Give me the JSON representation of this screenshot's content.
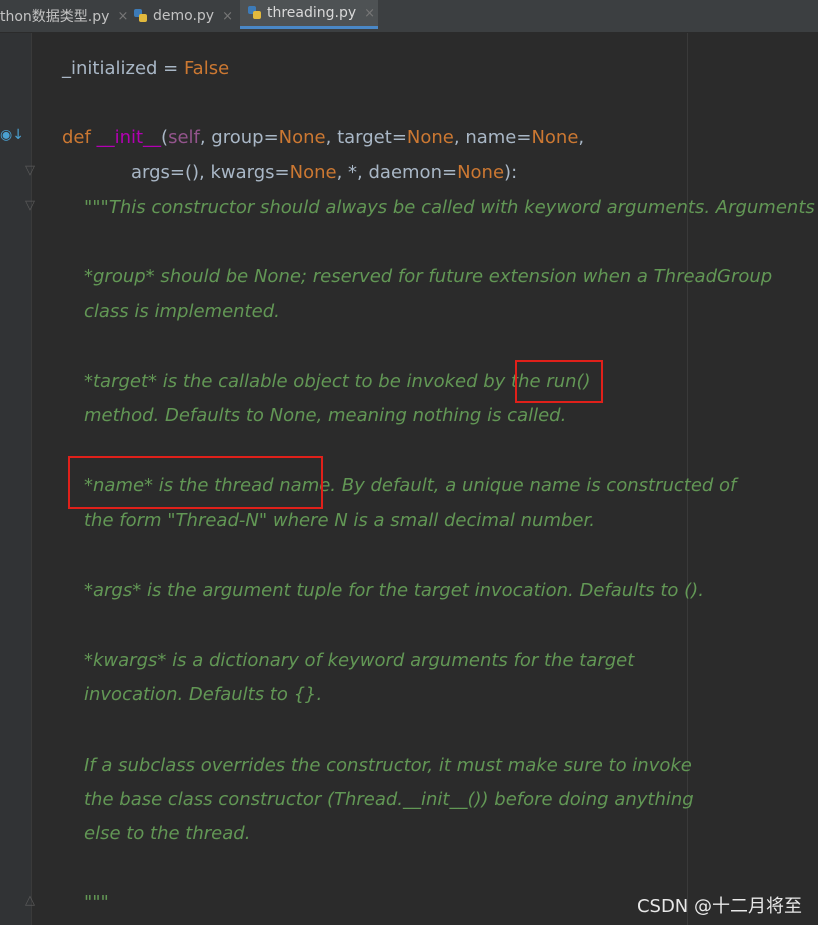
{
  "tabs": [
    {
      "label": "thon数据类型.py",
      "active": false
    },
    {
      "label": "demo.py",
      "active": false
    },
    {
      "label": "threading.py",
      "active": true
    }
  ],
  "close_glyph": "×",
  "code": {
    "line1": {
      "name": "_initialized",
      "op": " = ",
      "value": "False"
    },
    "def": {
      "kw": "def ",
      "fn": "__init__",
      "p1": "(",
      "self": "self",
      "rest1a": ", group=",
      "none1": "None",
      "rest1b": ", target=",
      "none2": "None",
      "rest1c": ", name=",
      "none3": "None",
      "rest1d": ",",
      "line2a": "args=(), kwargs=",
      "none4": "None",
      "line2b": ", *, daemon=",
      "none5": "None",
      "line2c": "):"
    },
    "docstring": [
      "\"\"\"This constructor should always be called with keyword arguments. Arguments are:",
      "",
      "*group* should be None; reserved for future extension when a ThreadGroup",
      "class is implemented.",
      "",
      "*target* is the callable object to be invoked by the run()",
      "method. Defaults to None, meaning nothing is called.",
      "",
      "*name* is the thread name. By default, a unique name is constructed of",
      "the form \"Thread-N\" where N is a small decimal number.",
      "",
      "*args* is the argument tuple for the target invocation. Defaults to ().",
      "",
      "*kwargs* is a dictionary of keyword arguments for the target",
      "invocation. Defaults to {}.",
      "",
      "If a subclass overrides the constructor, it must make sure to invoke",
      "the base class constructor (Thread.__init__()) before doing anything",
      "else to the thread.",
      "",
      "\"\"\""
    ]
  },
  "watermark": "CSDN @十二月将至",
  "colors": {
    "highlight_box": "#e0201a",
    "docstring": "#629755",
    "keyword": "#cc7832"
  }
}
